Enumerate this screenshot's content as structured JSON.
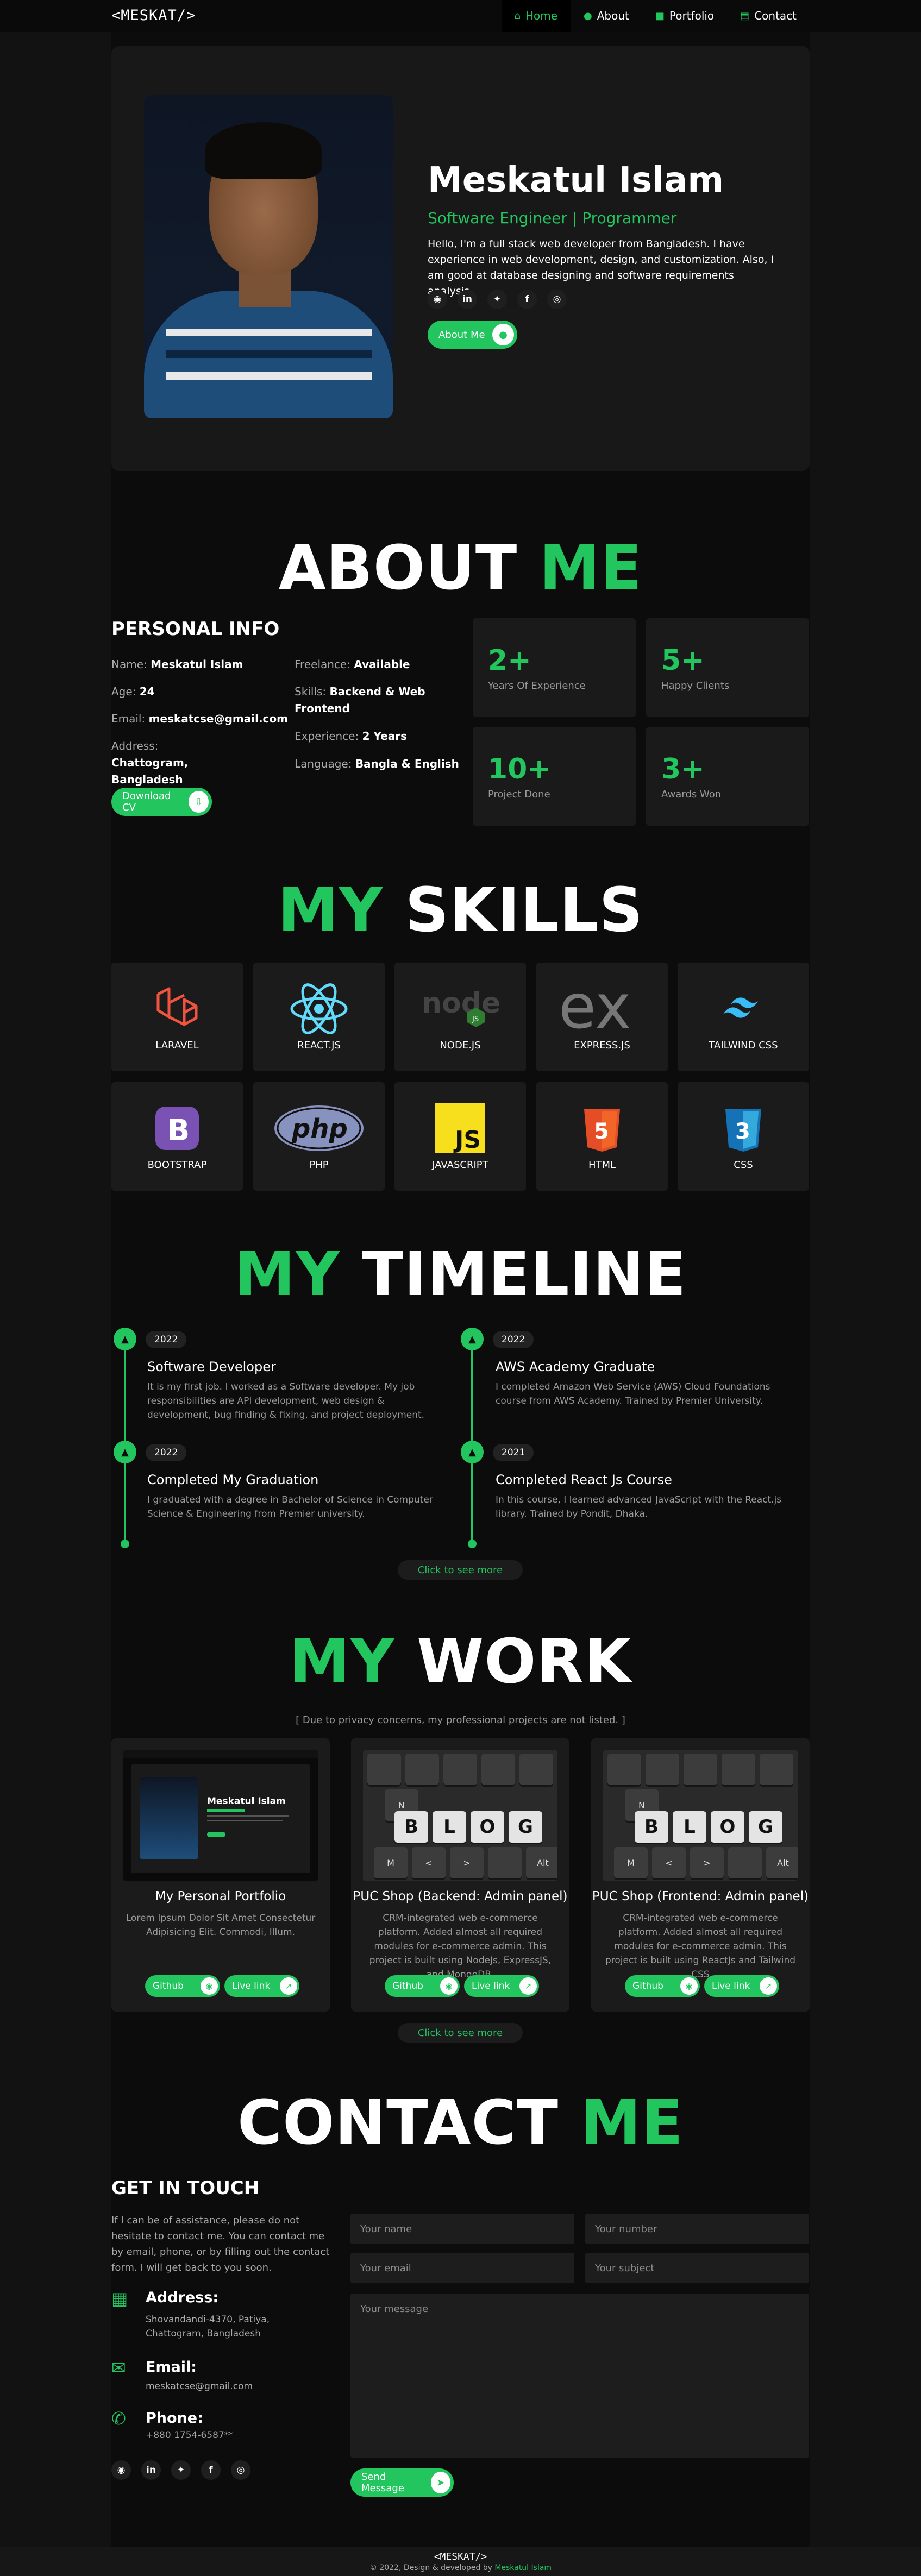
{
  "nav": {
    "logo": "<MESKAT/>",
    "links": [
      {
        "label": "Home",
        "icon": "home-icon",
        "active": true
      },
      {
        "label": "About",
        "icon": "user-icon"
      },
      {
        "label": "Portfolio",
        "icon": "briefcase-icon"
      },
      {
        "label": "Contact",
        "icon": "id-card-icon"
      }
    ]
  },
  "hero": {
    "name": "Meskatul Islam",
    "role": "Software Engineer | Programmer",
    "description": "Hello, I'm a full stack web developer from Bangladesh. I have experience in web development, design, and customization. Also, I am good at database designing and software requirements analysis.",
    "social": [
      "github-icon",
      "linkedin-icon",
      "twitter-icon",
      "facebook-icon",
      "instagram-icon"
    ],
    "about_button": "About Me"
  },
  "about": {
    "title_a": "ABOUT",
    "title_b": "ME",
    "heading": "PERSONAL INFO",
    "info": {
      "name_k": "Name:",
      "name_v": "Meskatul Islam",
      "age_k": "Age:",
      "age_v": "24",
      "email_k": "Email:",
      "email_v": "meskatcse@gmail.com",
      "address_k": "Address:",
      "address_v": "Chattogram, Bangladesh",
      "freelance_k": "Freelance:",
      "freelance_v": "Available",
      "skills_k": "Skills:",
      "skills_v": "Backend & Web Frontend",
      "experience_k": "Experience:",
      "experience_v": "2 Years",
      "language_k": "Language:",
      "language_v": "Bangla & English"
    },
    "cv_button": "Download CV",
    "stats": [
      {
        "num": "2+",
        "label": "Years Of Experience"
      },
      {
        "num": "5+",
        "label": "Happy Clients"
      },
      {
        "num": "10+",
        "label": "Project Done"
      },
      {
        "num": "3+",
        "label": "Awards Won"
      }
    ]
  },
  "skills": {
    "title_a": "MY",
    "title_b": "SKILLS",
    "items": [
      "LARAVEL",
      "REACT.JS",
      "NODE.JS",
      "EXPRESS.JS",
      "TAILWIND CSS",
      "BOOTSTRAP",
      "PHP",
      "JAVASCRIPT",
      "HTML",
      "CSS"
    ]
  },
  "timeline": {
    "title_a": "MY",
    "title_b": "TIMELINE",
    "items": [
      {
        "year": "2022",
        "title": "Software Developer",
        "desc": "It is my first job. I worked as a Software developer. My job responsibilities are API development, web design & development, bug finding & fixing, and project deployment."
      },
      {
        "year": "2022",
        "title": "AWS Academy Graduate",
        "desc": "I completed Amazon Web Service (AWS) Cloud Foundations course from AWS Academy. Trained by Premier University."
      },
      {
        "year": "2022",
        "title": "Completed My Graduation",
        "desc": "I graduated with a degree in Bachelor of Science in Computer Science & Engineering from Premier university."
      },
      {
        "year": "2021",
        "title": "Completed React Js Course",
        "desc": "In this course, I learned advanced JavaScript with the React.js library. Trained by Pondit, Dhaka."
      }
    ],
    "more": "Click to see more"
  },
  "work": {
    "title_a": "MY",
    "title_b": "WORK",
    "note": "[ Due to privacy concerns, my professional projects are not listed. ]",
    "cards": [
      {
        "title": "My Personal Portfolio",
        "desc": "Lorem Ipsum Dolor Sit Amet Consectetur Adipisicing Elit. Commodi, Illum.",
        "github": "Github",
        "live": "Live link",
        "thumb_name": "Meskatul Islam"
      },
      {
        "title": "PUC Shop (Backend: Admin panel)",
        "desc": "CRM-integrated web e-commerce platform. Added almost all required modules for e-commerce admin. This project is built using NodeJs, ExpressJS, and MongoDB.",
        "github": "Github",
        "live": "Live link"
      },
      {
        "title": "PUC Shop (Frontend: Admin panel)",
        "desc": "CRM-integrated web e-commerce platform. Added almost all required modules for e-commerce admin. This project is built using ReactJs and Tailwind CSS",
        "github": "Github",
        "live": "Live link"
      }
    ],
    "more": "Click to see more"
  },
  "contact": {
    "title_a": "CONTACT",
    "title_b": "ME",
    "heading": "GET IN TOUCH",
    "desc": "If I can be of assistance, please do not hesitate to contact me. You can contact me by email, phone, or by filling out the contact form. I will get back to you soon.",
    "address_h": "Address:",
    "address_v": "Shovandandi-4370, Patiya, Chattogram, Bangladesh",
    "email_h": "Email:",
    "email_v": "meskatcse@gmail.com",
    "phone_h": "Phone:",
    "phone_v": "+880 1754-6587**",
    "form": {
      "name": "Your name",
      "number": "Your number",
      "email": "Your email",
      "subject": "Your subject",
      "message": "Your message",
      "send": "Send Message"
    }
  },
  "footer": {
    "logo": "<MESKAT/>",
    "copy": "© 2022, Design & developed by",
    "author": "Meskatul Islam"
  },
  "colors": {
    "accent": "#22c55e",
    "bg": "#0c0c0c",
    "panel": "#1b1b1b"
  }
}
